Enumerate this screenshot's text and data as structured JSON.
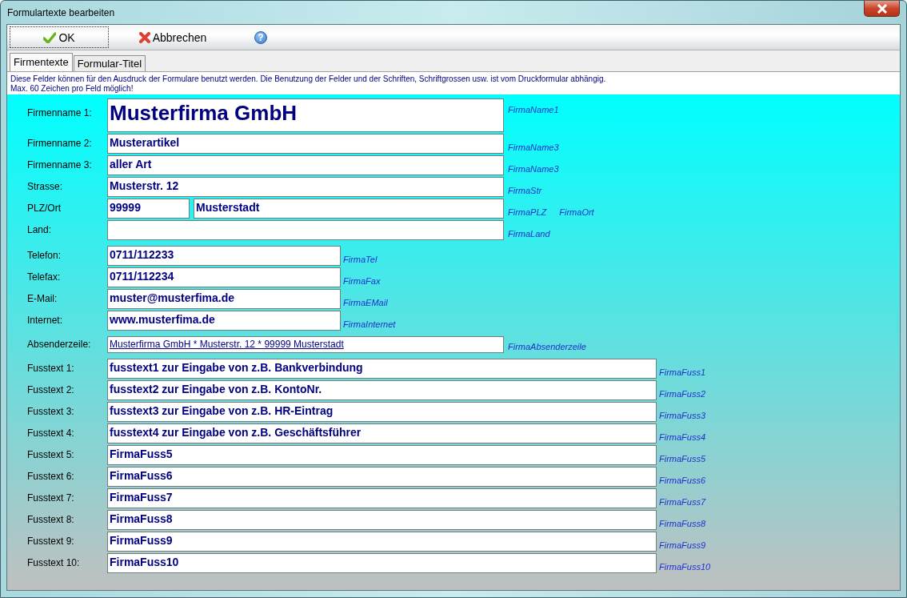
{
  "window": {
    "title": "Formulartexte bearbeiten"
  },
  "toolbar": {
    "buttons": [
      {
        "kind": "ok",
        "label": "OK",
        "focused": true
      },
      {
        "kind": "cancel",
        "label": "Abbrechen",
        "focused": false
      },
      {
        "kind": "help",
        "label": "?",
        "focused": false
      }
    ]
  },
  "tabs": [
    {
      "label": "Firmentexte",
      "selected": true
    },
    {
      "label": "Formular-Titel",
      "selected": false
    }
  ],
  "info": [
    "Diese Felder können für den Ausdruck der Formulare benutzt werden. Die Benutzung der Felder und der Schriften, Schriftgrossen usw. ist vom Druckformular abhängig.",
    "Max. 60 Zeichen pro Feld möglich!"
  ],
  "groups": [
    {
      "kind": "address",
      "rows": [
        {
          "label": "Firmenname 1:",
          "kind": "large",
          "values": [
            "Musterfirma GmbH"
          ],
          "hints": [
            "FirmaName1"
          ]
        },
        {
          "label": "Firmenname 2:",
          "kind": "normal",
          "values": [
            "Musterartikel"
          ],
          "hints": [
            "FirmaName3"
          ]
        },
        {
          "label": "Firmenname 3:",
          "kind": "normal",
          "values": [
            "aller Art"
          ],
          "hints": [
            "FirmaName3"
          ]
        },
        {
          "label": "Strasse:",
          "kind": "normal",
          "values": [
            "Musterstr. 12"
          ],
          "hints": [
            "FirmaStr"
          ]
        },
        {
          "label": "PLZ/Ort",
          "kind": "pair",
          "values": [
            "99999",
            "Musterstadt"
          ],
          "hints": [
            "FirmaPLZ",
            "FirmaOrt"
          ]
        },
        {
          "label": "Land:",
          "kind": "normal",
          "values": [],
          "hints": [
            "FirmaLand"
          ]
        }
      ]
    },
    {
      "kind": "contact",
      "rows": [
        {
          "label": "Telefon:",
          "kind": "normal",
          "values": [
            "0711/112233"
          ],
          "hints": [
            "FirmaTel"
          ]
        },
        {
          "label": "Telefax:",
          "kind": "normal",
          "values": [
            "0711/112234"
          ],
          "hints": [
            "FirmaFax"
          ]
        },
        {
          "label": "E-Mail:",
          "kind": "normal",
          "values": [
            "muster@musterfima.de"
          ],
          "hints": [
            "FirmaEMail"
          ]
        },
        {
          "label": "Internet:",
          "kind": "normal",
          "values": [
            "www.musterfima.de"
          ],
          "hints": [
            "FirmaInternet"
          ]
        }
      ]
    },
    {
      "kind": "sender",
      "rows": [
        {
          "label": "Absenderzeile:",
          "kind": "link",
          "values": [
            "Musterfirma GmbH * Musterstr. 12 * 99999 Musterstadt"
          ],
          "hints": [
            "FirmaAbsenderzeile"
          ]
        }
      ]
    },
    {
      "kind": "footer",
      "rows": [
        {
          "label": "Fusstext 1:",
          "kind": "normal",
          "values": [
            "fusstext1 zur Eingabe von z.B. Bankverbindung"
          ],
          "hints": [
            "FirmaFuss1"
          ]
        },
        {
          "label": "Fusstext 2:",
          "kind": "normal",
          "values": [
            "fusstext2 zur Eingabe von z.B. KontoNr."
          ],
          "hints": [
            "FirmaFuss2"
          ]
        },
        {
          "label": "Fusstext 3:",
          "kind": "normal",
          "values": [
            "fusstext3 zur Eingabe von z.B. HR-Eintrag"
          ],
          "hints": [
            "FirmaFuss3"
          ]
        },
        {
          "label": "Fusstext 4:",
          "kind": "normal",
          "values": [
            "fusstext4 zur Eingabe von z.B. Geschäftsführer"
          ],
          "hints": [
            "FirmaFuss4"
          ]
        },
        {
          "label": "Fusstext 5:",
          "kind": "normal",
          "values": [
            "FirmaFuss5"
          ],
          "hints": [
            "FirmaFuss5"
          ]
        },
        {
          "label": "Fusstext 6:",
          "kind": "normal",
          "values": [
            "FirmaFuss6"
          ],
          "hints": [
            "FirmaFuss6"
          ]
        },
        {
          "label": "Fusstext 7:",
          "kind": "normal",
          "values": [
            "FirmaFuss7"
          ],
          "hints": [
            "FirmaFuss7"
          ]
        },
        {
          "label": "Fusstext 8:",
          "kind": "normal",
          "values": [
            "FirmaFuss8"
          ],
          "hints": [
            "FirmaFuss8"
          ]
        },
        {
          "label": "Fusstext 9:",
          "kind": "normal",
          "values": [
            "FirmaFuss9"
          ],
          "hints": [
            "FirmaFuss9"
          ]
        },
        {
          "label": "Fusstext 10:",
          "kind": "normal",
          "values": [
            "FirmaFuss10"
          ],
          "hints": [
            "FirmaFuss10"
          ]
        }
      ]
    }
  ]
}
